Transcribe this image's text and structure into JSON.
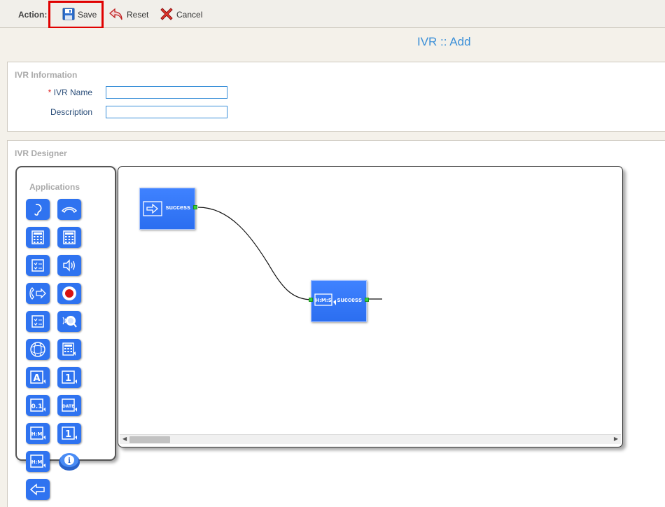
{
  "toolbar": {
    "action_label": "Action:",
    "save_label": "Save",
    "reset_label": "Reset",
    "cancel_label": "Cancel"
  },
  "page": {
    "title": "IVR :: Add"
  },
  "ivr_information": {
    "title": "IVR Information",
    "required_marker": "*",
    "name_label": "IVR Name",
    "name_value": "",
    "description_label": "Description",
    "description_value": ""
  },
  "designer": {
    "title": "IVR Designer",
    "palette_title": "Applications",
    "applications": [
      "ear-icon",
      "hangup-icon",
      "keypad-icon",
      "keypad-icon",
      "checklist-icon",
      "speaker-icon",
      "call-transfer-icon",
      "record-icon",
      "checklist-icon",
      "speech-search-icon",
      "globe-icon",
      "keypad-speaker-icon",
      "say-alpha-icon",
      "say-number-icon",
      "say-digits-icon",
      "say-date-icon",
      "say-time-icon",
      "say-number-icon",
      "say-time-icon",
      "info-icon",
      "back-arrow-icon"
    ],
    "nodes": [
      {
        "type": "start",
        "icon": "start-arrow-icon",
        "output_label": "success"
      },
      {
        "type": "say-time",
        "icon": "say-time-icon",
        "output_label": "success"
      }
    ]
  },
  "colors": {
    "accent": "#3a8fd8",
    "node_blue": "#2f73f0",
    "port_green": "#36d33a",
    "highlight_red": "#e00000"
  }
}
